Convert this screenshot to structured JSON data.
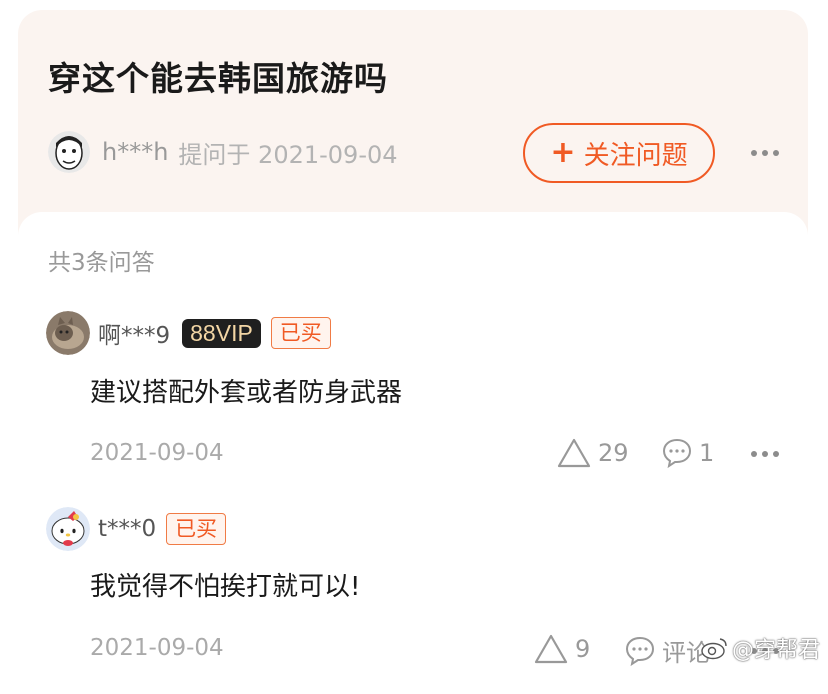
{
  "question": {
    "title": "穿这个能去韩国旅游吗",
    "asker": "h***h",
    "asked_at": "提问于 2021-09-04",
    "follow_label": "关注问题"
  },
  "answers_count": "共3条问答",
  "answers": [
    {
      "user": "啊***9",
      "vip_badge": "88VIP",
      "bought_badge": "已买",
      "text": "建议搭配外套或者防身武器",
      "date": "2021-09-04",
      "likes": "29",
      "comments": "1"
    },
    {
      "user": "t***0",
      "bought_badge": "已买",
      "text": "我觉得不怕挨打就可以!",
      "date": "2021-09-04",
      "likes": "9",
      "comments": "评论"
    }
  ],
  "watermark": "@穿帮君",
  "colors": {
    "accent": "#f05a24",
    "header_bg": "#fbf4f0"
  }
}
